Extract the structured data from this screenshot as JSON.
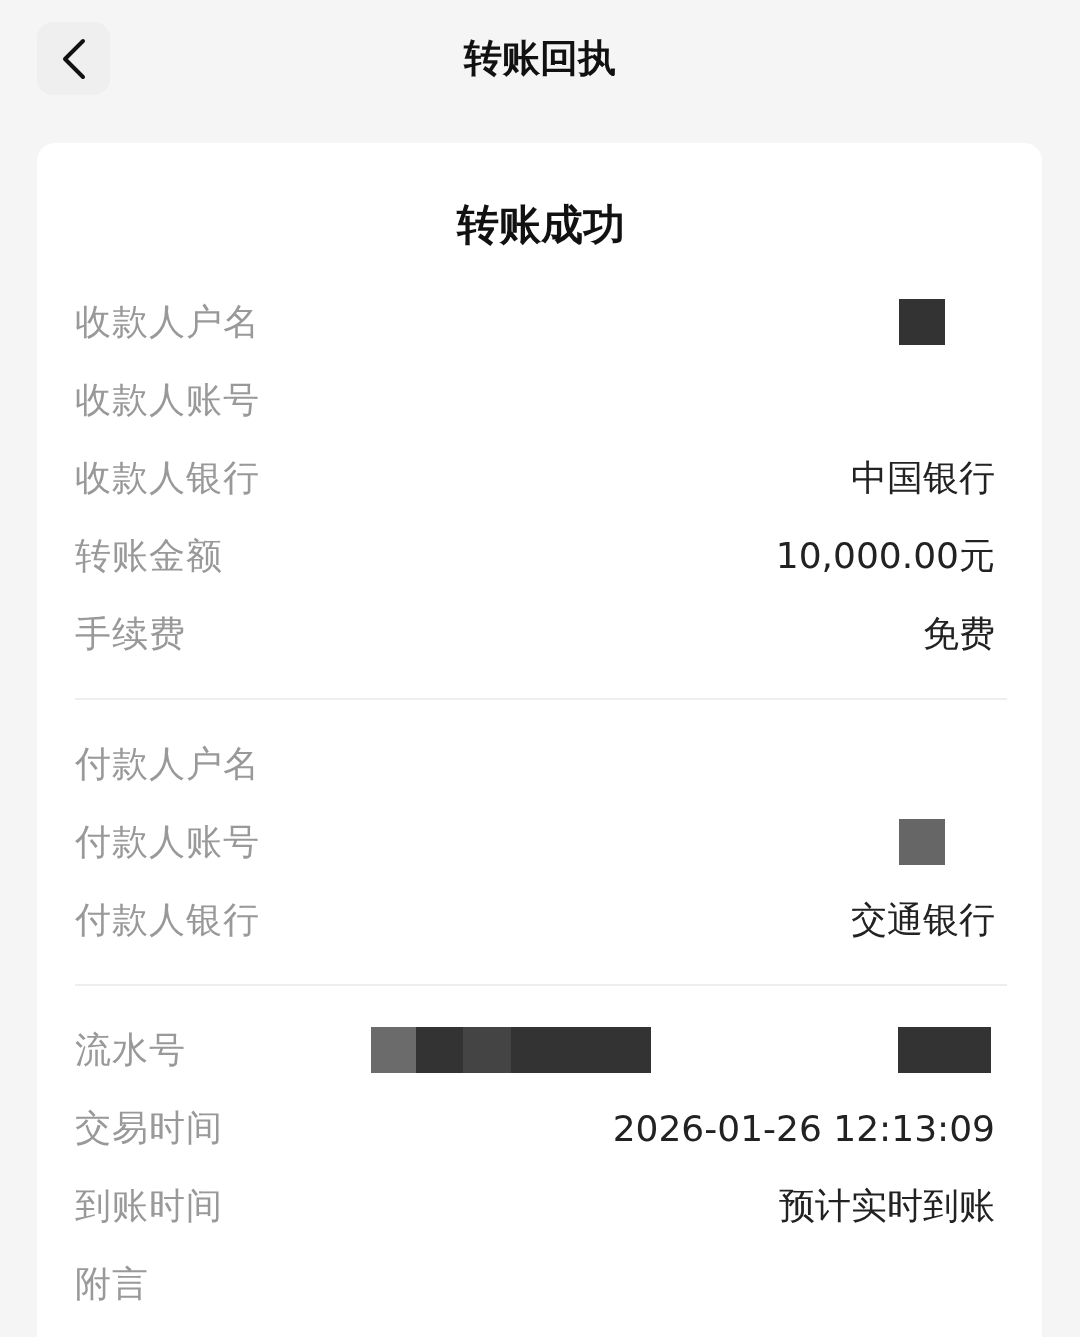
{
  "header": {
    "title": "转账回执"
  },
  "card": {
    "status": "转账成功",
    "sections": [
      {
        "rows": [
          {
            "label": "收款人户名",
            "kind": "masked"
          },
          {
            "label": "收款人账号",
            "kind": "blank"
          },
          {
            "label": "收款人银行",
            "kind": "text",
            "value": "中国银行"
          },
          {
            "label": "转账金额",
            "kind": "text",
            "value": "10,000.00元"
          },
          {
            "label": "手续费",
            "kind": "text",
            "value": "免费"
          }
        ]
      },
      {
        "rows": [
          {
            "label": "付款人户名",
            "kind": "blank"
          },
          {
            "label": "付款人账号",
            "kind": "masked_light"
          },
          {
            "label": "付款人银行",
            "kind": "text",
            "value": "交通银行"
          }
        ]
      },
      {
        "rows": [
          {
            "label": "流水号",
            "kind": "masked_serial"
          },
          {
            "label": "交易时间",
            "kind": "text",
            "value": "2026-01-26 12:13:09"
          },
          {
            "label": "到账时间",
            "kind": "text",
            "value": "预计实时到账"
          },
          {
            "label": "附言",
            "kind": "blank"
          }
        ]
      }
    ]
  }
}
